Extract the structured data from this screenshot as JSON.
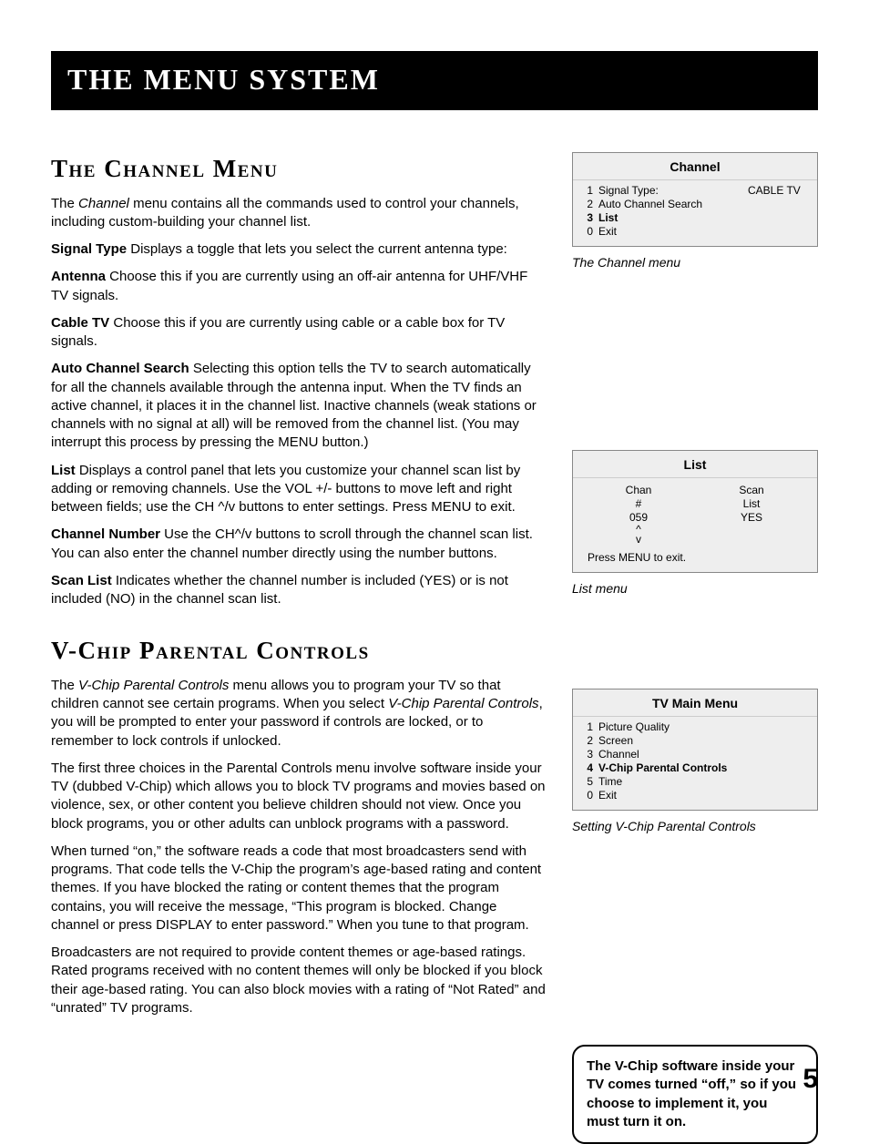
{
  "header": {
    "title": "The Menu System"
  },
  "left": {
    "sec1": {
      "heading": "The Channel Menu",
      "intro_a": "The ",
      "intro_b_ital": "Channel",
      "intro_c": " menu contains all the commands used to control your channels, including custom-building your channel list.",
      "signal_type_label": "Signal Type",
      "signal_type_text": "  Displays a toggle that lets you select the current antenna type:",
      "antenna_label": "Antenna",
      "antenna_text": "   Choose this if you are currently using an off-air antenna for UHF/VHF TV signals.",
      "cable_label": "Cable TV",
      "cable_text": "   Choose this if you are currently using cable or a cable box for TV signals.",
      "acs_label": "Auto Channel Search",
      "acs_text": "  Selecting this option tells the TV to search automatically for all the channels available through the antenna input. When the TV finds an active channel, it places it in the channel list.  Inactive channels (weak stations or channels with no signal at all) will be removed from the channel list. (You may interrupt this process by pressing the MENU button.)",
      "list_label": "List",
      "list_text": "  Displays a control panel that lets you customize your channel scan list by adding or removing channels. Use the VOL +/- buttons to move left and right between fields; use the CH ^/v buttons to enter settings. Press MENU to exit.",
      "chan_num_label": "Channel Number",
      "chan_num_text": "   Use the CH^/v buttons to scroll through the channel scan list. You can also enter the channel number directly using the number buttons.",
      "scan_list_label": "Scan List",
      "scan_list_text": "   Indicates whether the channel number is included (YES) or is not included (NO) in the channel scan list."
    },
    "sec2": {
      "heading": "V-Chip Parental Controls",
      "p1_a": "The ",
      "p1_b_ital": "V-Chip Parental Controls",
      "p1_c": " menu allows you to program your TV so that children cannot see certain programs. When you select ",
      "p1_d_ital": "V-Chip Parental Controls",
      "p1_e": ", you will be prompted to enter your password if controls are locked, or to remember to lock controls if unlocked.",
      "p2": "The first three choices in the Parental Controls menu involve software inside your TV (dubbed V-Chip) which allows you to block TV programs and movies based on violence, sex, or other content you believe children should not view. Once you block programs, you or other adults can unblock programs with a password.",
      "p3": "When turned “on,” the software reads a code that most broadcasters send with programs. That code tells the V-Chip the program’s age-based rating and content themes. If you have blocked the rating or content themes that the program contains, you will receive the message, “This program is blocked. Change channel or press DISPLAY to enter password.” When you tune to that program.",
      "p4": "Broadcasters are not required to provide content themes or age-based ratings. Rated programs received with no content themes will only be blocked if you block their age-based rating. You can also block movies with a rating of “Not Rated” and “unrated” TV programs."
    }
  },
  "right": {
    "channel_panel": {
      "title": "Channel",
      "rows": [
        {
          "n": "1",
          "label": "Signal Type:",
          "val": "CABLE TV",
          "sel": false
        },
        {
          "n": "2",
          "label": "Auto Channel Search",
          "val": "",
          "sel": false
        },
        {
          "n": "3",
          "label": "List",
          "val": "",
          "sel": true
        },
        {
          "n": "0",
          "label": "Exit",
          "val": "",
          "sel": false
        }
      ],
      "caption": "The Channel menu"
    },
    "list_panel": {
      "title": "List",
      "colA": [
        "Chan",
        "#",
        "059",
        "^",
        "v"
      ],
      "colB": [
        "Scan",
        "List",
        "YES"
      ],
      "footer": "Press MENU to exit.",
      "caption": "List menu"
    },
    "main_panel": {
      "title": "TV Main Menu",
      "rows": [
        {
          "n": "1",
          "label": "Picture Quality",
          "sel": false
        },
        {
          "n": "2",
          "label": "Screen",
          "sel": false
        },
        {
          "n": "3",
          "label": "Channel",
          "sel": false
        },
        {
          "n": "4",
          "label": "V-Chip Parental Controls",
          "sel": true
        },
        {
          "n": "5",
          "label": "Time",
          "sel": false
        },
        {
          "n": "0",
          "label": "Exit",
          "sel": false
        }
      ],
      "caption": "Setting V-Chip Parental Controls"
    },
    "info_box": "The V-Chip software inside your TV comes turned “off,” so if you choose to implement it, you must turn it on."
  },
  "page_number": "5"
}
